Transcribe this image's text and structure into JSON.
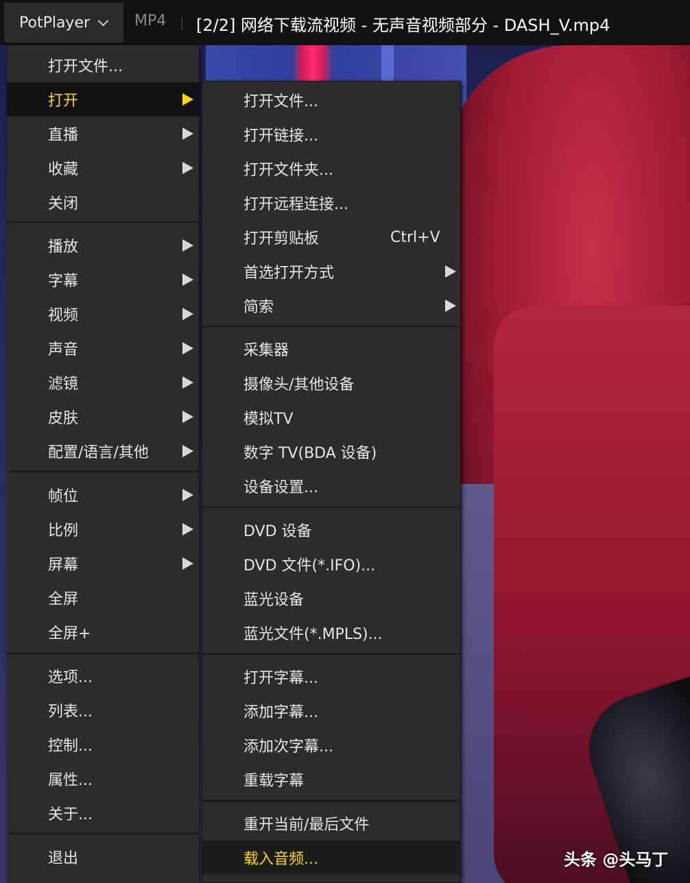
{
  "titlebar": {
    "app_name": "PotPlayer",
    "format": "MP4",
    "window_title": "[2/2] 网络下载流视频 - 无声音视频部分 - DASH_V.mp4"
  },
  "main_menu": {
    "items": [
      {
        "label": "打开文件..."
      },
      {
        "label": "打开"
      },
      {
        "label": "直播"
      },
      {
        "label": "收藏"
      },
      {
        "label": "关闭"
      },
      {
        "label": "播放"
      },
      {
        "label": "字幕"
      },
      {
        "label": "视频"
      },
      {
        "label": "声音"
      },
      {
        "label": "滤镜"
      },
      {
        "label": "皮肤"
      },
      {
        "label": "配置/语言/其他"
      },
      {
        "label": "帧位"
      },
      {
        "label": "比例"
      },
      {
        "label": "屏幕"
      },
      {
        "label": "全屏"
      },
      {
        "label": "全屏+"
      },
      {
        "label": "选项..."
      },
      {
        "label": "列表..."
      },
      {
        "label": "控制..."
      },
      {
        "label": "属性..."
      },
      {
        "label": "关于..."
      },
      {
        "label": "退出"
      }
    ]
  },
  "open_submenu": {
    "items": [
      {
        "label": "打开文件..."
      },
      {
        "label": "打开链接..."
      },
      {
        "label": "打开文件夹..."
      },
      {
        "label": "打开远程连接..."
      },
      {
        "label": "打开剪贴板",
        "shortcut": "Ctrl+V"
      },
      {
        "label": "首选打开方式"
      },
      {
        "label": "简索"
      },
      {
        "label": "采集器"
      },
      {
        "label": "摄像头/其他设备"
      },
      {
        "label": "模拟TV"
      },
      {
        "label": "数字 TV(BDA 设备)"
      },
      {
        "label": "设备设置..."
      },
      {
        "label": "DVD 设备"
      },
      {
        "label": "DVD 文件(*.IFO)..."
      },
      {
        "label": "蓝光设备"
      },
      {
        "label": "蓝光文件(*.MPLS)..."
      },
      {
        "label": "打开字幕..."
      },
      {
        "label": "添加字幕..."
      },
      {
        "label": "添加次字幕..."
      },
      {
        "label": "重载字幕"
      },
      {
        "label": "重开当前/最后文件"
      },
      {
        "label": "载入音频..."
      }
    ]
  },
  "watermark": "头条 @头马丁",
  "colors": {
    "menu_bg": "#2c2c2c",
    "menu_text": "#e6e6e6",
    "highlight_text": "#ffd700",
    "titlebar_bg": "#121212"
  }
}
